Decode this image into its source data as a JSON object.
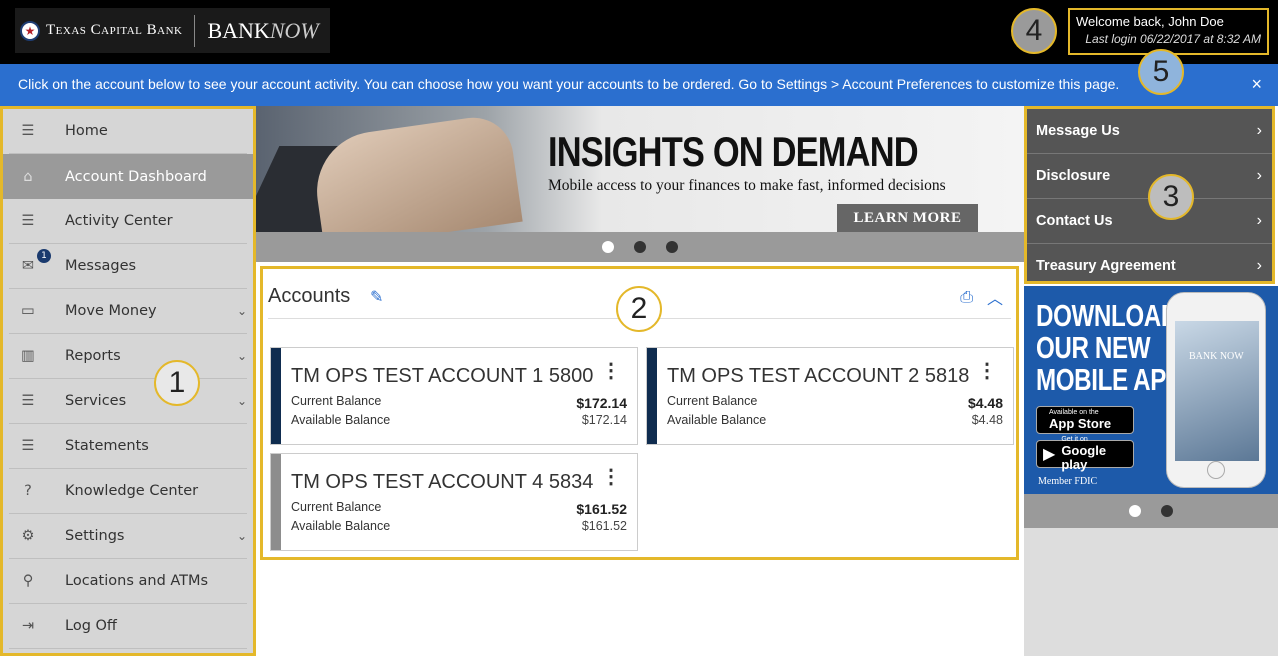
{
  "header": {
    "bank_name": "Texas Capital Bank",
    "product_name": "BANK",
    "product_name_italic": "NOW",
    "welcome": "Welcome back, John Doe",
    "last_login": "Last login 06/22/2017 at 8:32 AM"
  },
  "info_bar": {
    "text": "Click on the account below to see your account activity. You can choose how you want your accounts to be ordered. Go to Settings > Account Preferences to customize this page.",
    "close": "×"
  },
  "sidebar": {
    "items": [
      {
        "label": "Home",
        "icon": "menu-icon",
        "glyph": "☰"
      },
      {
        "label": "Account Dashboard",
        "icon": "house-icon",
        "glyph": "⌂"
      },
      {
        "label": "Activity Center",
        "icon": "menu-icon",
        "glyph": "☰"
      },
      {
        "label": "Messages",
        "icon": "envelope-icon",
        "glyph": "✉",
        "badge": "1"
      },
      {
        "label": "Move Money",
        "icon": "card-icon",
        "glyph": "▭",
        "chevron": "⌄"
      },
      {
        "label": "Reports",
        "icon": "bar-chart-icon",
        "glyph": "▥",
        "chevron": "⌄"
      },
      {
        "label": "Services",
        "icon": "menu-icon",
        "glyph": "☰",
        "chevron": "⌄"
      },
      {
        "label": "Statements",
        "icon": "menu-icon",
        "glyph": "☰"
      },
      {
        "label": "Knowledge Center",
        "icon": "help-icon",
        "glyph": "?"
      },
      {
        "label": "Settings",
        "icon": "gear-icon",
        "glyph": "⚙",
        "chevron": "⌄"
      },
      {
        "label": "Locations and ATMs",
        "icon": "map-pin-icon",
        "glyph": "⚲"
      },
      {
        "label": "Log Off",
        "icon": "logout-icon",
        "glyph": "⇥"
      }
    ]
  },
  "banner": {
    "headline": "INSIGHTS ON DEMAND",
    "subline": "Mobile access to your finances to make fast, informed decisions",
    "cta": "LEARN MORE",
    "slide_count": 3,
    "active_slide": 1
  },
  "accounts": {
    "title": "Accounts",
    "kebab": "⋮",
    "cards": [
      {
        "name": "TM OPS TEST ACCOUNT 1 5800",
        "current_label": "Current Balance",
        "current": "$172.14",
        "available_label": "Available Balance",
        "available": "$172.14",
        "stripe": "#0f2c4f"
      },
      {
        "name": "TM OPS TEST ACCOUNT 2 5818",
        "current_label": "Current Balance",
        "current": "$4.48",
        "available_label": "Available Balance",
        "available": "$4.48",
        "stripe": "#0f2c4f"
      },
      {
        "name": "TM OPS TEST ACCOUNT 4 5834",
        "current_label": "Current Balance",
        "current": "$161.52",
        "available_label": "Available Balance",
        "available": "$161.52",
        "stripe": "#8d8d8d"
      }
    ]
  },
  "right_links": [
    {
      "label": "Message Us"
    },
    {
      "label": "Disclosure"
    },
    {
      "label": "Contact Us"
    },
    {
      "label": "Treasury Agreement"
    }
  ],
  "app_ad": {
    "line1": "DOWNLOAD",
    "line2": "OUR NEW",
    "line3": "MOBILE APP",
    "apple_small": "Available on the",
    "apple_big": "App Store",
    "google_small": "Get it on",
    "google_big": "Google play",
    "fdic": "Member FDIC",
    "phone_text": "BANK NOW"
  },
  "callouts": [
    "1",
    "2",
    "3",
    "4",
    "5"
  ],
  "colors": {
    "accent": "#2b6fcf",
    "highlight": "#e4b82a",
    "navy": "#0f2c4f"
  }
}
